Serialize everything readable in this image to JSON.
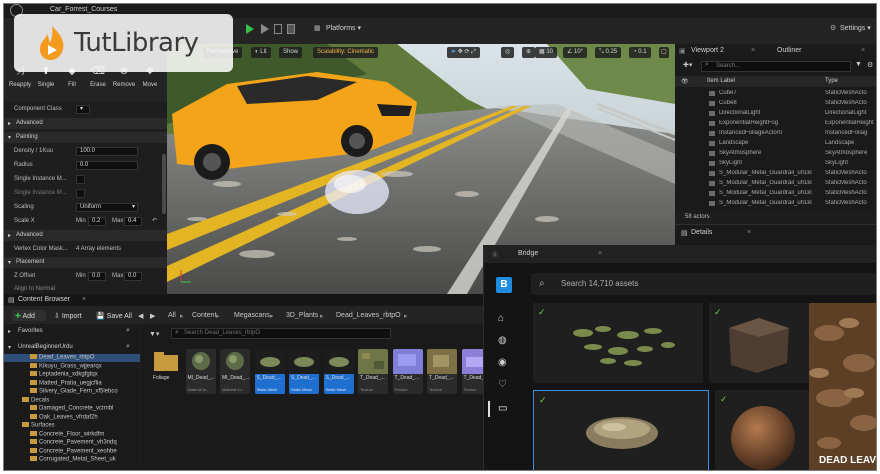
{
  "watermark": {
    "name": "TutLibrary"
  },
  "titlebar": {
    "project": "Car_Forrest_Courses"
  },
  "toolbar": {
    "platforms_label": "Platforms",
    "settings_label": "Settings"
  },
  "left_panel": {
    "tools": [
      "Reapply",
      "Single",
      "Fill",
      "Erase",
      "Remove",
      "Move"
    ],
    "component_class_label": "Component Class",
    "sections": {
      "advanced": "Advanced",
      "painting": "Painting",
      "advanced2": "Advanced",
      "placement": "Placement"
    },
    "props": {
      "density_label": "Density / 1Kuu",
      "density_value": "100.0",
      "radius_label": "Radius",
      "radius_value": "0.0",
      "single_instance_label": "Single Instance M...",
      "single_instance2_label": "Single Instance M...",
      "scaling_label": "Scaling",
      "scaling_value": "Uniform",
      "scale_x_label": "Scale X",
      "scale_x_min_label": "Min",
      "scale_x_min": "0.2",
      "scale_x_max_label": "Max",
      "scale_x_max": "0.4",
      "vertex_color_label": "Vertex Color Mask...",
      "vertex_color_value": "4 Array elements",
      "z_offset_label": "Z Offset",
      "z_offset_min_label": "Min",
      "z_offset_min": "0.0",
      "z_offset_max_label": "Max",
      "z_offset_max": "0.0",
      "align_label": "Align to Normal"
    }
  },
  "viewport": {
    "perspective": "Perspective",
    "lit": "Lit",
    "show": "Show",
    "scalability": "Scalability: Cinematic",
    "grid": "10",
    "angle": "10°",
    "scale": "0.25",
    "speed": "0.1"
  },
  "outliner": {
    "tab_viewport": "Viewport 2",
    "tab_outliner": "Outliner",
    "search_placeholder": "Search...",
    "col_label": "Item Label",
    "col_type": "Type",
    "rows": [
      {
        "name": "Cube7",
        "type": "StaticMeshActo"
      },
      {
        "name": "Cube8",
        "type": "StaticMeshActo"
      },
      {
        "name": "DirectionalLight",
        "type": "DirectionalLight"
      },
      {
        "name": "ExponentialHeightFog",
        "type": "ExponentialHeight"
      },
      {
        "name": "InstancedFoliageActor0",
        "type": "InstancedFoliag"
      },
      {
        "name": "Landscape",
        "type": "Landscape"
      },
      {
        "name": "SkyAtmosphere",
        "type": "SkyAtmosphere"
      },
      {
        "name": "SkyLight",
        "type": "SkyLight"
      },
      {
        "name": "S_Modular_Metal_Guardrail_uh1kl",
        "type": "StaticMeshActo"
      },
      {
        "name": "S_Modular_Metal_Guardrail_uh1kl",
        "type": "StaticMeshActo"
      },
      {
        "name": "S_Modular_Metal_Guardrail_uh1kl",
        "type": "StaticMeshActo"
      },
      {
        "name": "S_Modular_Metal_Guardrail_uh1kl",
        "type": "StaticMeshActo"
      }
    ],
    "actor_count": "58 actors"
  },
  "details": {
    "title": "Details"
  },
  "content_browser": {
    "tab": "Content Browser",
    "add": "Add",
    "import": "Import",
    "save_all": "Save All",
    "breadcrumb": [
      "All",
      "Content",
      "Megascans",
      "3D_Plants",
      "Dead_Leaves_rbtpO"
    ],
    "search_placeholder": "Search Dead_Leaves_rbtpO",
    "favorites": "Favorites",
    "root": "UnrealBeginnerUrdu",
    "tree": [
      "Dead_Leaves_rbtpO",
      "Kikuyu_Grass_wjjearqx",
      "Leptadenia_xdkgfgtqx",
      "Matted_Pratia_uegjcflia",
      "Silvery_Glade_Fern_xf5lebco",
      "Decals",
      "Damaged_Concrete_vctmbl",
      "Oak_Leaves_vfrdaf2h",
      "Surfaces",
      "Concrete_Floor_wirkdfm",
      "Concrete_Pavement_vh3ndq",
      "Concrete_Pavement_xeohbe",
      "Corrugated_Metal_Sheet_uk"
    ],
    "assets": [
      {
        "name": "Foliage",
        "type": ""
      },
      {
        "name": "MI_Dead_...",
        "type": "Material In..."
      },
      {
        "name": "MI_Dead_...",
        "type": "Material In..."
      },
      {
        "name": "S_Dead_...",
        "type": "Static Mesh"
      },
      {
        "name": "S_Dead_...",
        "type": "Static Mesh"
      },
      {
        "name": "S_Dead_...",
        "type": "Static Mesh"
      },
      {
        "name": "T_Dead_...",
        "type": "Texture"
      },
      {
        "name": "T_Dead_...",
        "type": "Texture"
      },
      {
        "name": "T_Dead_...",
        "type": "Texture"
      },
      {
        "name": "T_Dead_...",
        "type": "Texture"
      }
    ]
  },
  "bridge": {
    "title": "Bridge",
    "search_placeholder": "Search 14,710 assets",
    "featured_label": "DEAD LEAVE"
  }
}
